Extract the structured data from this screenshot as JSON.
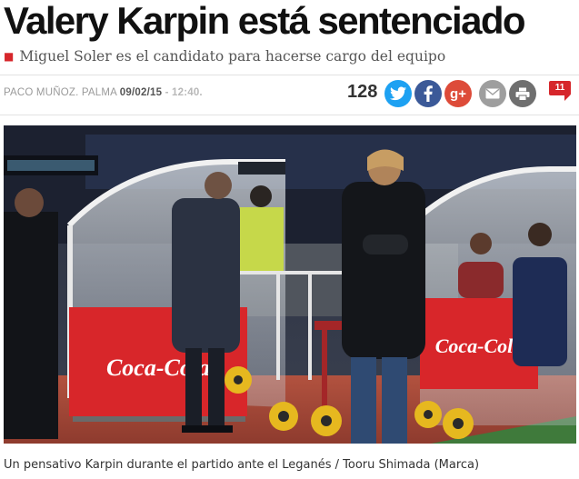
{
  "article": {
    "headline": "Valery Karpin está sentenciado",
    "subtitle": "Miguel Soler es el candidato para hacerse cargo del equipo",
    "byline": {
      "author": "PACO MUÑOZ. PALMA",
      "date": "09/02/15",
      "separator": " - ",
      "time": "12:40."
    },
    "photo_caption": "Un pensativo Karpin durante el partido ante el Leganés / Tooru Shimada (Marca)",
    "photo_signage": [
      "Coca-Cola",
      "Coca-Cola"
    ]
  },
  "share": {
    "count": "128",
    "comments_count": "11",
    "buttons": [
      {
        "icon": "twitter-icon",
        "color": "#1da1f2"
      },
      {
        "icon": "facebook-icon",
        "color": "#3b5998"
      },
      {
        "icon": "googleplus-icon",
        "label": "g+",
        "color": "#dd4b39"
      },
      {
        "icon": "email-icon",
        "color": "#9e9e9e"
      },
      {
        "icon": "print-icon",
        "color": "#6f6f6f"
      }
    ]
  },
  "colors": {
    "accent": "#d6262b",
    "headline": "#111111"
  }
}
